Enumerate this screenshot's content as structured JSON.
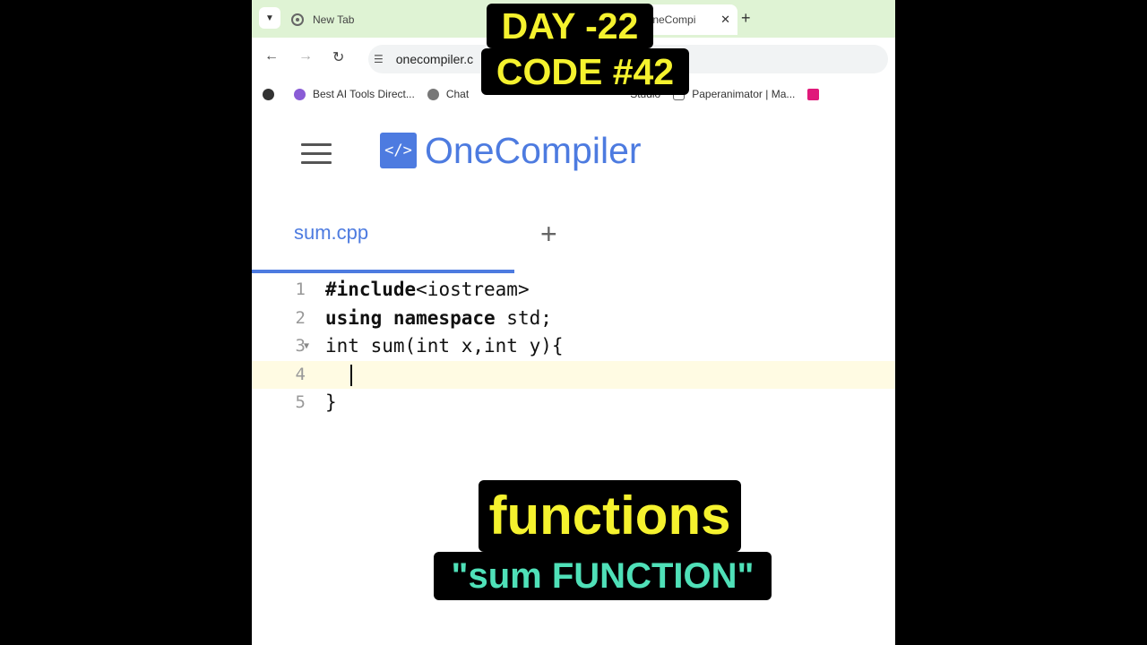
{
  "browser": {
    "tabs": [
      {
        "label": "New Tab"
      },
      {
        "label": "OneCompi"
      }
    ],
    "address": "onecompiler.c",
    "bookmarks": [
      {
        "label": "Best AI Tools Direct..."
      },
      {
        "label": "Chat"
      },
      {
        "label": "Studio"
      },
      {
        "label": "Paperanimator | Ma..."
      }
    ]
  },
  "app": {
    "logo_icon": "</>",
    "logo_text": "OneCompiler",
    "file_tab": "sum.cpp",
    "add_tab": "+"
  },
  "editor": {
    "lines": [
      {
        "num": "1",
        "kw": "#include",
        "rest": "<iostream>"
      },
      {
        "num": "2",
        "kw": "using namespace",
        "rest": " std;"
      },
      {
        "num": "3",
        "kw": "",
        "rest": "int sum(int x,int y){"
      },
      {
        "num": "4",
        "kw": "",
        "rest": ""
      },
      {
        "num": "5",
        "kw": "",
        "rest": "}"
      }
    ]
  },
  "overlay": {
    "day": "DAY -22",
    "code": "CODE #42",
    "topic": "functions",
    "subtitle": "\"sum FUNCTION\""
  },
  "colors": {
    "brand": "#4d7be0",
    "overlay_yellow": "#f5f22e",
    "overlay_teal": "#4fe0b8"
  }
}
